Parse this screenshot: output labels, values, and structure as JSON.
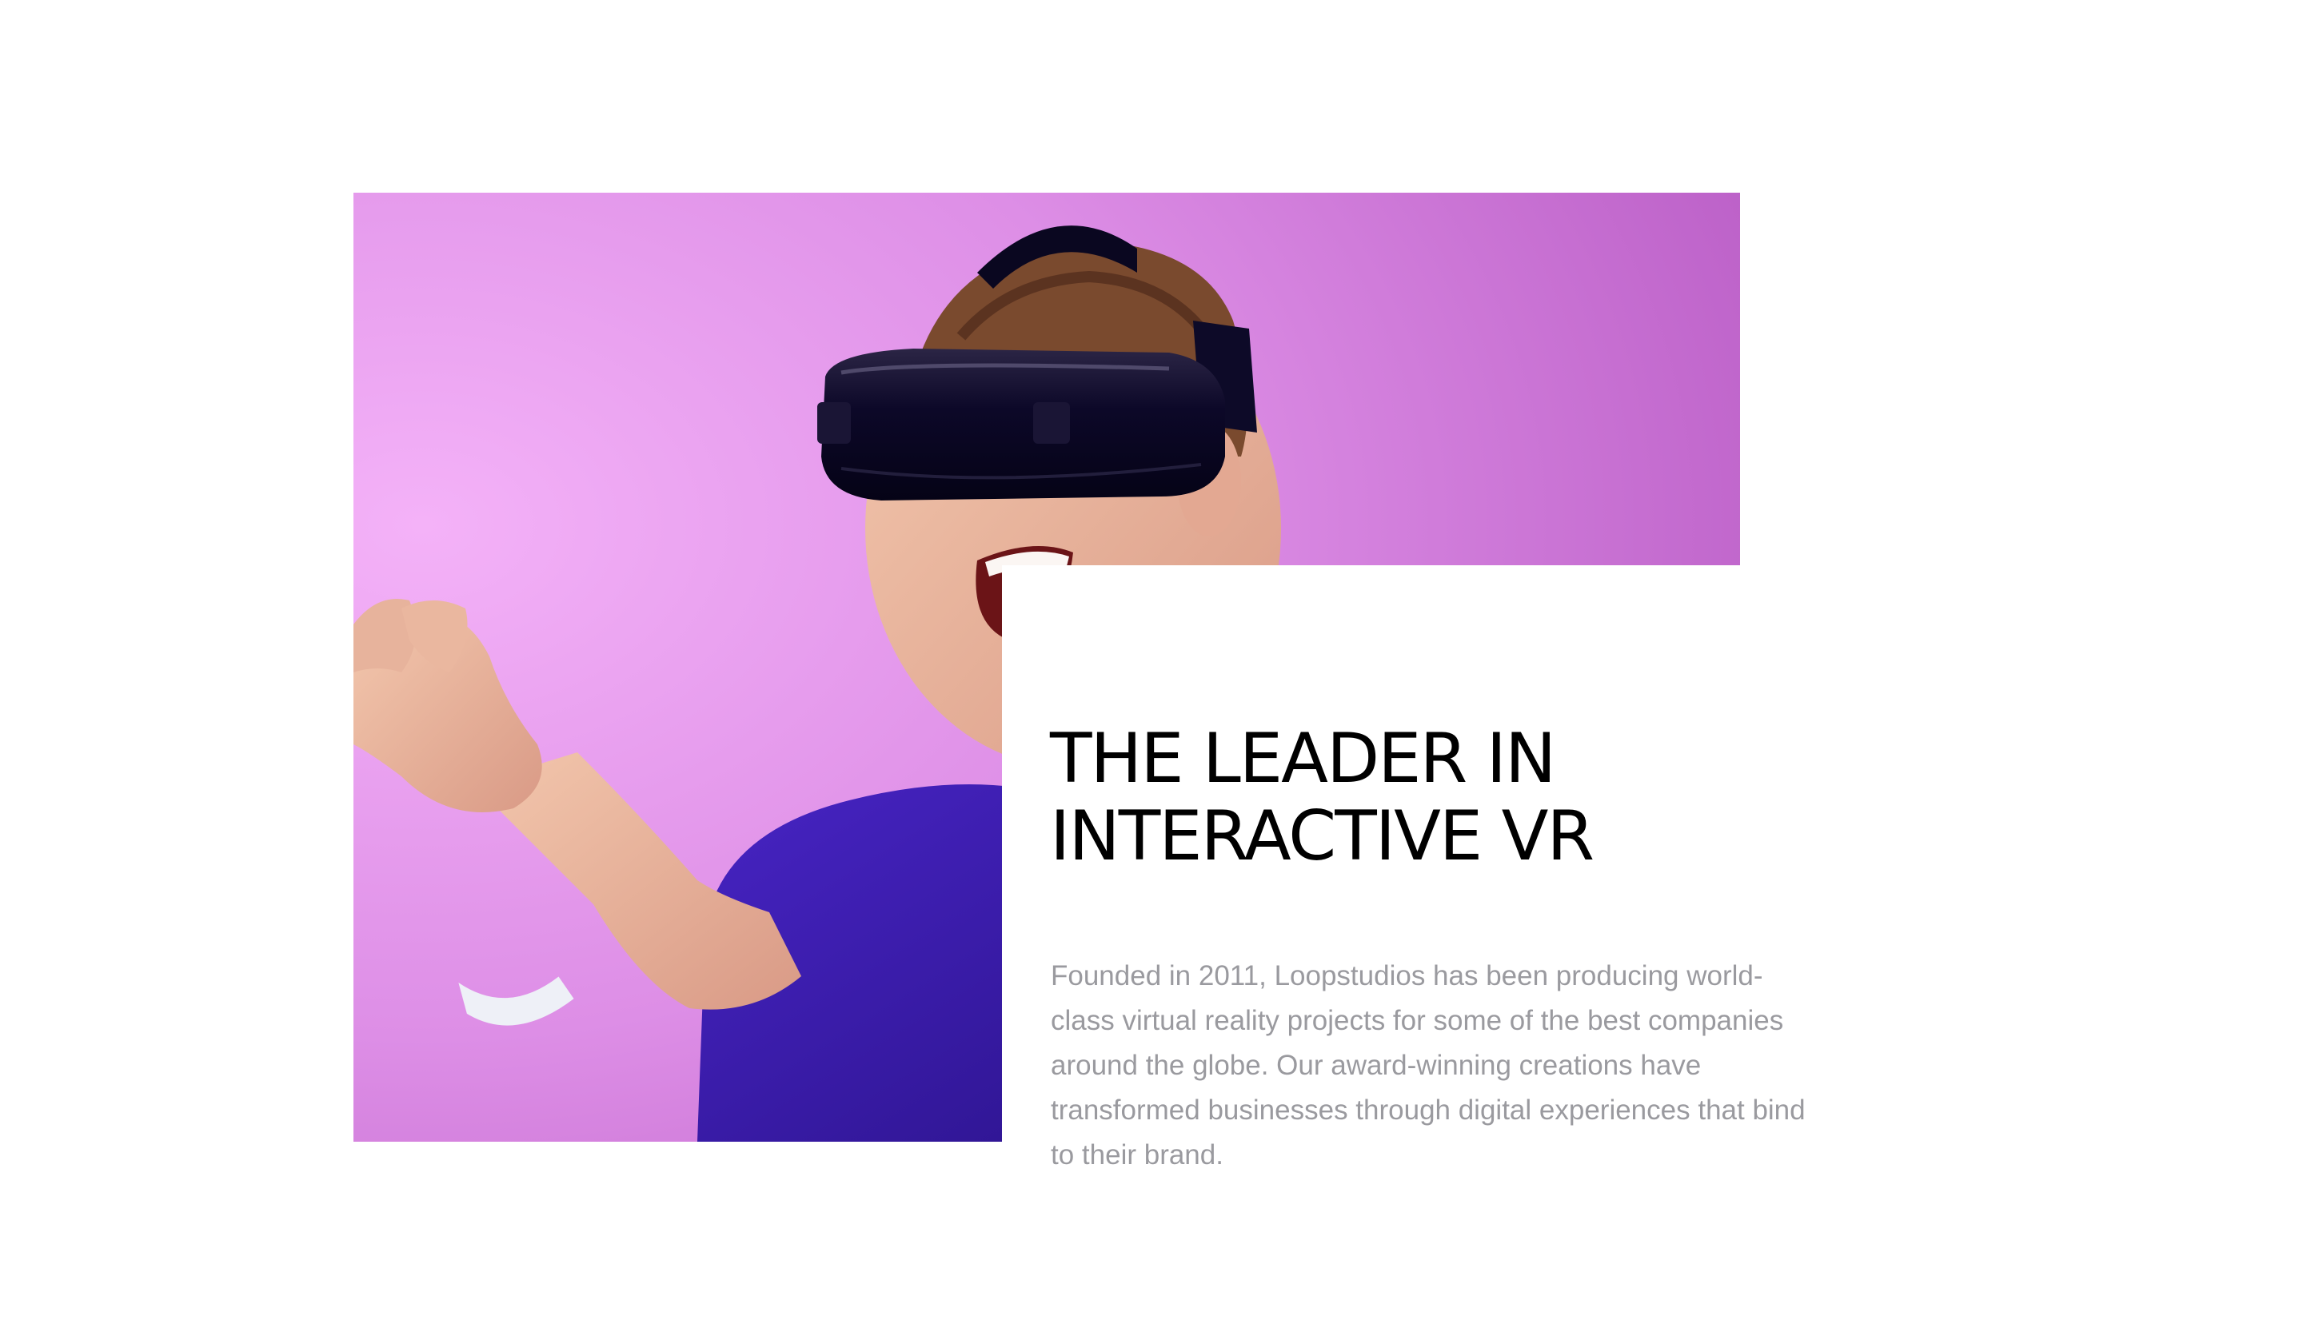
{
  "about": {
    "heading_line1": "THE LEADER IN",
    "heading_line2": "INTERACTIVE VR",
    "description": "Founded in 2011, Loopstudios has been producing world-class virtual reality projects for some of the best companies around the globe. Our award-winning creations have transformed businesses through digital experiences that bind to their brand.",
    "image_alt": "Man wearing a VR headset against a purple background"
  },
  "colors": {
    "heading": "#000000",
    "body_text": "#9a9a9f",
    "image_bg_light": "#f0a8f5",
    "image_bg_dark": "#b455bf",
    "shirt": "#3a1aa8",
    "headset": "#0b0724"
  },
  "icons": {
    "hero_image": "vr-user-photo"
  }
}
